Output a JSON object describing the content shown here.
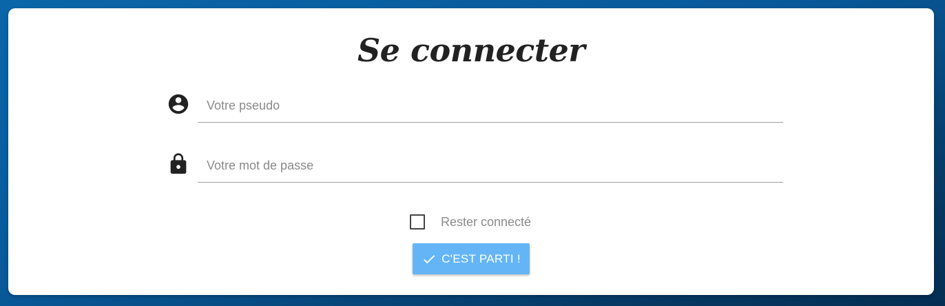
{
  "login": {
    "title": "Se connecter",
    "username": {
      "placeholder": "Votre pseudo",
      "value": "",
      "icon": "account-circle-icon"
    },
    "password": {
      "placeholder": "Votre mot de passe",
      "value": "",
      "icon": "lock-icon"
    },
    "remember": {
      "label": "Rester connecté",
      "checked": false
    },
    "submit": {
      "label": "C'EST PARTI !",
      "icon": "check-icon"
    }
  },
  "colors": {
    "background": "#08599a",
    "card": "#ffffff",
    "button": "#64b5f6",
    "title_text": "#222222",
    "placeholder_text": "#8a8a8a"
  }
}
